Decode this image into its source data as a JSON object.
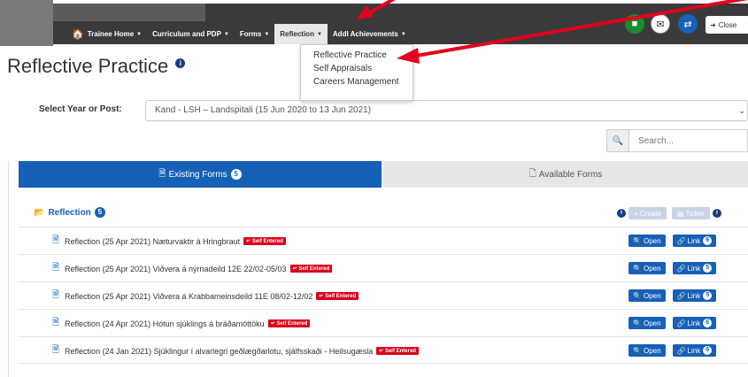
{
  "nav": {
    "items": [
      {
        "label": "Trainee Home",
        "has_caret": true
      },
      {
        "label": "Curriculum and PDP",
        "has_caret": true
      },
      {
        "label": "Forms",
        "has_caret": true
      },
      {
        "label": "Reflection",
        "has_caret": true,
        "active": true
      },
      {
        "label": "Addl Achievements",
        "has_caret": true
      }
    ],
    "close_label": "Close",
    "circle_colors": [
      "#1a8a2e",
      "#ffffff",
      "#1660b8"
    ]
  },
  "dropdown": {
    "items": [
      "Reflective Practice",
      "Self Appraisals",
      "Careers Management"
    ]
  },
  "page": {
    "title": "Reflective Practice",
    "select_label": "Select Year or Post:",
    "select_value": "Kand - LSH – Landspitali (15 Jun 2020 to 13 Jun 2021)",
    "search_placeholder": "Search..."
  },
  "tabs": {
    "existing_label": "Existing Forms",
    "existing_count": "5",
    "available_label": "Available Forms"
  },
  "list": {
    "header_label": "Reflection",
    "header_count": "5",
    "create_label": "+ Create",
    "ticker_label": "Ticker",
    "open_label": "Open",
    "link_label": "Link",
    "self_badge": "Self Entered",
    "rows": [
      {
        "text": "Reflection (25 Apr 2021) Næturvaktir á Hringbraut",
        "link_count": "6"
      },
      {
        "text": "Reflection (25 Apr 2021) Viðvera á nýrnadeild 12E 22/02-05/03",
        "link_count": "5"
      },
      {
        "text": "Reflection (25 Apr 2021) Viðvera á Krabbameinsdeild 11E 08/02-12/02",
        "link_count": "5"
      },
      {
        "text": "Reflection (24 Apr 2021) Hótun sjúklings á bráðamóttöku",
        "link_count": "6"
      },
      {
        "text": "Reflection (24 Jan 2021) Sjúklingur í alvarlegri geðlægðarlotu, sjálfsskaði - Heilsugæsla",
        "link_count": "6"
      }
    ]
  },
  "colors": {
    "primary": "#1660b8",
    "navbar": "#3a3a3a",
    "danger": "#d9001b",
    "arrow": "#e3001b"
  }
}
